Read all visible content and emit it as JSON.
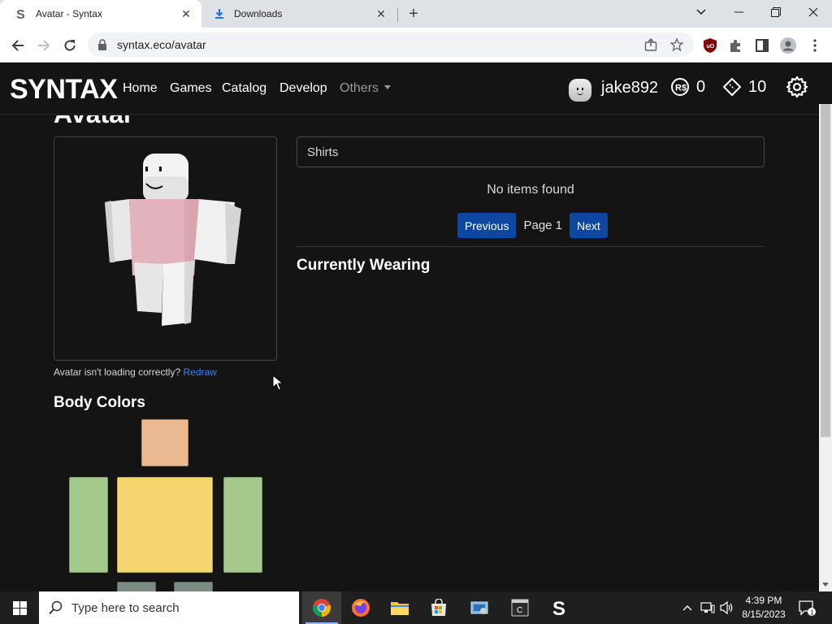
{
  "browser": {
    "tabs": [
      {
        "title": "Avatar - Syntax",
        "active": true
      },
      {
        "title": "Downloads",
        "active": false
      }
    ],
    "url": "syntax.eco/avatar"
  },
  "site": {
    "logo": "SYNTAX",
    "nav": [
      {
        "label": "Home"
      },
      {
        "label": "Games"
      },
      {
        "label": "Catalog"
      },
      {
        "label": "Develop"
      },
      {
        "label": "Others"
      }
    ],
    "username": "jake892",
    "robux": "0",
    "tix": "10"
  },
  "page": {
    "heading": "Avatar",
    "help_text": "Avatar isn't loading correctly? ",
    "redraw_link": "Redraw",
    "body_colors_title": "Body Colors",
    "body_colors": {
      "head": "#ebb991",
      "torso": "#f5d56e",
      "left_arm": "#a4c98c",
      "right_arm": "#a4c98c",
      "left_leg": "#7c8c84",
      "right_leg": "#7c8c84"
    },
    "item_type": "Shirts",
    "no_items": "No items found",
    "prev_label": "Previous",
    "page_label": "Page 1",
    "next_label": "Next",
    "currently_wearing_title": "Currently Wearing"
  },
  "taskbar": {
    "search_placeholder": "Type here to search",
    "time": "4:39 PM",
    "date": "8/15/2023",
    "notifications": "1"
  }
}
